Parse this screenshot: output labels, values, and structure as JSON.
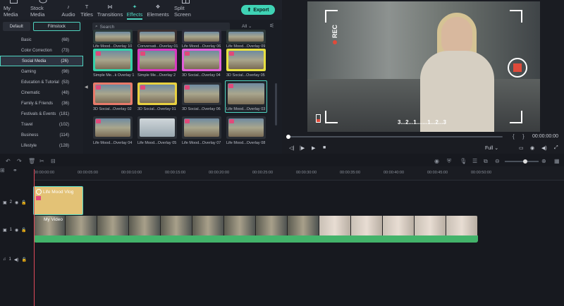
{
  "nav": {
    "items": [
      {
        "label": "My Media",
        "icon": "folder-icon"
      },
      {
        "label": "Stock Media",
        "icon": "cloud-icon"
      },
      {
        "label": "Audio",
        "icon": "music-note-icon"
      },
      {
        "label": "Titles",
        "icon": "text-icon"
      },
      {
        "label": "Transitions",
        "icon": "transition-icon"
      },
      {
        "label": "Effects",
        "icon": "sparkle-icon"
      },
      {
        "label": "Elements",
        "icon": "elements-icon"
      },
      {
        "label": "Split Screen",
        "icon": "split-screen-icon"
      }
    ],
    "export_label": "Export"
  },
  "sidebar": {
    "tab_default": "Default",
    "tab_filmstock": "Filmstock",
    "categories": [
      {
        "label": "Basic",
        "count": "(68)"
      },
      {
        "label": "Color Correction",
        "count": "(73)"
      },
      {
        "label": "Social Media",
        "count": "(26)"
      },
      {
        "label": "Gaming",
        "count": "(98)"
      },
      {
        "label": "Education & Tutorial",
        "count": "(53)"
      },
      {
        "label": "Cinematic",
        "count": "(48)"
      },
      {
        "label": "Family & Friends",
        "count": "(36)"
      },
      {
        "label": "Festivals & Events",
        "count": "(181)"
      },
      {
        "label": "Travel",
        "count": "(102)"
      },
      {
        "label": "Business",
        "count": "(114)"
      },
      {
        "label": "Lifestyle",
        "count": "(128)"
      }
    ]
  },
  "gallery": {
    "search_placeholder": "Search",
    "filter_value": "All",
    "items": [
      {
        "label": "Life Mood...Overlay 10"
      },
      {
        "label": "Conversati...Overlay 01"
      },
      {
        "label": "Life Mood...Overlay 06"
      },
      {
        "label": "Life Mood...Overlay 09"
      },
      {
        "label": "Simple Me...k Overlay 1"
      },
      {
        "label": "Simple Me...Overlay 2"
      },
      {
        "label": "3D Social...Overlay 04"
      },
      {
        "label": "3D Social...Overlay 05"
      },
      {
        "label": "3D Social...Overlay 02"
      },
      {
        "label": "3D Social...Overlay 01"
      },
      {
        "label": "3D Social...Overlay 06"
      },
      {
        "label": "Life Mood...Overlay 03"
      },
      {
        "label": "Life Mood...Overlay 04"
      },
      {
        "label": "Life Mood...Overlay 05"
      },
      {
        "label": "Life Mood...Overlay 07"
      },
      {
        "label": "Life Mood...Overlay 08"
      }
    ]
  },
  "preview": {
    "rec_label": "REC",
    "countdown": "3...2...1.......1...2...3",
    "time": "00:00:00:00",
    "quality": "Full"
  },
  "timeline": {
    "ticks": [
      "00:00:00:00",
      "00:00:05:00",
      "00:00:10:00",
      "00:00:15:00",
      "00:00:20:00",
      "00:00:25:00",
      "00:00:30:00",
      "00:00:35:00",
      "00:00:40:00",
      "00:00:45:00",
      "00:00:50:00"
    ],
    "tracks": [
      {
        "label": "2"
      },
      {
        "label": "1"
      },
      {
        "label": "1"
      }
    ],
    "overlay_clip_label": "Life Mood Vlog",
    "video_clip_label": "My Video"
  }
}
